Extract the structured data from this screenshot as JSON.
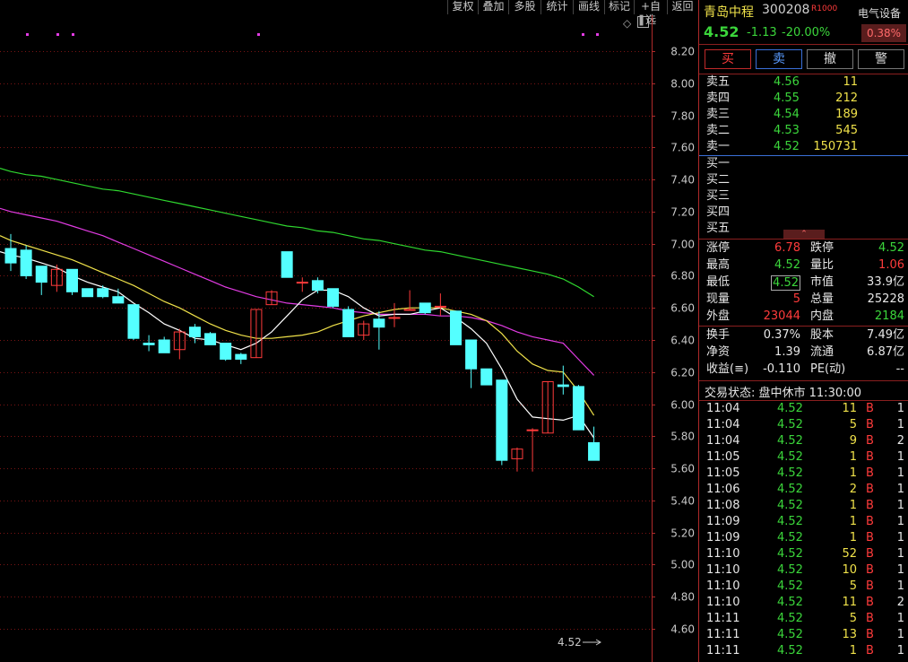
{
  "toolbar": {
    "items": [
      "复权",
      "叠加",
      "多股",
      "统计",
      "画线",
      "标记",
      "+自选",
      "返回"
    ]
  },
  "stock": {
    "name": "青岛中程",
    "code": "300208",
    "tag": "R",
    "sector": "电气设备",
    "sector_change": "0.38%",
    "price": "4.52",
    "change": "-1.13",
    "change_pct": "-20.00%"
  },
  "trade_buttons": [
    "买",
    "卖",
    "撤",
    "警"
  ],
  "asks": [
    {
      "label": "卖五",
      "price": "4.56",
      "vol": "11"
    },
    {
      "label": "卖四",
      "price": "4.55",
      "vol": "212"
    },
    {
      "label": "卖三",
      "price": "4.54",
      "vol": "189"
    },
    {
      "label": "卖二",
      "price": "4.53",
      "vol": "545"
    },
    {
      "label": "卖一",
      "price": "4.52",
      "vol": "150731"
    }
  ],
  "bids": [
    {
      "label": "买一"
    },
    {
      "label": "买二"
    },
    {
      "label": "买三"
    },
    {
      "label": "买四"
    },
    {
      "label": "买五"
    }
  ],
  "stats": [
    {
      "l1": "涨停",
      "v1": "6.78",
      "c1": "red",
      "l2": "跌停",
      "v2": "4.52",
      "c2": "green"
    },
    {
      "l1": "最高",
      "v1": "4.52",
      "c1": "green",
      "l2": "量比",
      "v2": "1.06",
      "c2": "red"
    },
    {
      "l1": "最低",
      "v1": "4.52",
      "c1": "green",
      "l2": "市值",
      "v2": "33.9亿",
      "c2": "white"
    },
    {
      "l1": "现量",
      "v1": "5",
      "c1": "red",
      "l2": "总量",
      "v2": "25228",
      "c2": "white"
    },
    {
      "l1": "外盘",
      "v1": "23044",
      "c1": "red",
      "l2": "内盘",
      "v2": "2184",
      "c2": "green"
    }
  ],
  "stats2": [
    {
      "l1": "换手",
      "v1": "0.37%",
      "l2": "股本",
      "v2": "7.49亿"
    },
    {
      "l1": "净资",
      "v1": "1.39",
      "l2": "流通",
      "v2": "6.87亿"
    },
    {
      "l1": "收益(≡)",
      "v1": "-0.110",
      "l2": "PE(动)",
      "v2": "--"
    }
  ],
  "trade_status": "交易状态: 盘中休市 11:30:00",
  "ticks": [
    {
      "t": "11:04",
      "p": "4.52",
      "v": "11",
      "s": "B",
      "n": "1"
    },
    {
      "t": "11:04",
      "p": "4.52",
      "v": "5",
      "s": "B",
      "n": "1"
    },
    {
      "t": "11:04",
      "p": "4.52",
      "v": "9",
      "s": "B",
      "n": "2"
    },
    {
      "t": "11:05",
      "p": "4.52",
      "v": "1",
      "s": "B",
      "n": "1"
    },
    {
      "t": "11:05",
      "p": "4.52",
      "v": "1",
      "s": "B",
      "n": "1"
    },
    {
      "t": "11:06",
      "p": "4.52",
      "v": "2",
      "s": "B",
      "n": "1"
    },
    {
      "t": "11:08",
      "p": "4.52",
      "v": "1",
      "s": "B",
      "n": "1"
    },
    {
      "t": "11:09",
      "p": "4.52",
      "v": "1",
      "s": "B",
      "n": "1"
    },
    {
      "t": "11:09",
      "p": "4.52",
      "v": "1",
      "s": "B",
      "n": "1"
    },
    {
      "t": "11:10",
      "p": "4.52",
      "v": "52",
      "s": "B",
      "n": "1"
    },
    {
      "t": "11:10",
      "p": "4.52",
      "v": "10",
      "s": "B",
      "n": "1"
    },
    {
      "t": "11:10",
      "p": "4.52",
      "v": "5",
      "s": "B",
      "n": "1"
    },
    {
      "t": "11:10",
      "p": "4.52",
      "v": "11",
      "s": "B",
      "n": "2"
    },
    {
      "t": "11:11",
      "p": "4.52",
      "v": "5",
      "s": "B",
      "n": "1"
    },
    {
      "t": "11:11",
      "p": "4.52",
      "v": "13",
      "s": "B",
      "n": "1"
    },
    {
      "t": "11:11",
      "p": "4.52",
      "v": "1",
      "s": "B",
      "n": "1"
    }
  ],
  "chart_data": {
    "type": "candlestick",
    "ylim": [
      4.55,
      8.3
    ],
    "y_ticks": [
      "8.20",
      "8.00",
      "7.80",
      "7.60",
      "7.40",
      "7.20",
      "7.00",
      "6.80",
      "6.60",
      "6.40",
      "6.20",
      "6.00",
      "5.80",
      "5.60",
      "5.40",
      "5.20",
      "5.00",
      "4.80",
      "4.60"
    ],
    "last_price_label": "4.52",
    "colors": {
      "up": "#ff3b3b",
      "down": "#54ffff",
      "ma5": "#ffffff",
      "ma10": "#f0e24a",
      "ma20": "#e23be3",
      "ma60": "#2fd82f",
      "grid": "#7a1414"
    },
    "candles": [
      {
        "o": 6.97,
        "h": 7.06,
        "c": 6.88,
        "l": 6.83
      },
      {
        "o": 6.96,
        "h": 6.99,
        "c": 6.8,
        "l": 6.78
      },
      {
        "o": 6.86,
        "h": 6.86,
        "c": 6.76,
        "l": 6.68
      },
      {
        "o": 6.74,
        "h": 6.87,
        "c": 6.84,
        "l": 6.7
      },
      {
        "o": 6.84,
        "h": 6.84,
        "c": 6.7,
        "l": 6.68
      },
      {
        "o": 6.72,
        "h": 6.72,
        "c": 6.67,
        "l": 6.67
      },
      {
        "o": 6.72,
        "h": 6.74,
        "c": 6.67,
        "l": 6.66
      },
      {
        "o": 6.67,
        "h": 6.72,
        "c": 6.63,
        "l": 6.63
      },
      {
        "o": 6.62,
        "h": 6.62,
        "c": 6.41,
        "l": 6.4
      },
      {
        "o": 6.38,
        "h": 6.43,
        "c": 6.37,
        "l": 6.33
      },
      {
        "o": 6.4,
        "h": 6.42,
        "c": 6.32,
        "l": 6.32
      },
      {
        "o": 6.34,
        "h": 6.47,
        "c": 6.45,
        "l": 6.28
      },
      {
        "o": 6.48,
        "h": 6.5,
        "c": 6.42,
        "l": 6.38
      },
      {
        "o": 6.44,
        "h": 6.45,
        "c": 6.37,
        "l": 6.37
      },
      {
        "o": 6.38,
        "h": 6.38,
        "c": 6.28,
        "l": 6.27
      },
      {
        "o": 6.31,
        "h": 6.32,
        "c": 6.28,
        "l": 6.25
      },
      {
        "o": 6.29,
        "h": 6.59,
        "c": 6.59,
        "l": 6.29
      },
      {
        "o": 6.62,
        "h": 6.71,
        "c": 6.7,
        "l": 6.62
      },
      {
        "o": 6.95,
        "h": 6.95,
        "c": 6.79,
        "l": 6.79
      },
      {
        "o": 6.76,
        "h": 6.79,
        "c": 6.76,
        "l": 6.7
      },
      {
        "o": 6.77,
        "h": 6.79,
        "c": 6.71,
        "l": 6.69
      },
      {
        "o": 6.72,
        "h": 6.72,
        "c": 6.61,
        "l": 6.6
      },
      {
        "o": 6.59,
        "h": 6.61,
        "c": 6.42,
        "l": 6.42
      },
      {
        "o": 6.43,
        "h": 6.52,
        "c": 6.5,
        "l": 6.4
      },
      {
        "o": 6.53,
        "h": 6.58,
        "c": 6.48,
        "l": 6.34
      },
      {
        "o": 6.54,
        "h": 6.63,
        "c": 6.54,
        "l": 6.48
      },
      {
        "o": 6.59,
        "h": 6.71,
        "c": 6.59,
        "l": 6.59
      },
      {
        "o": 6.63,
        "h": 6.63,
        "c": 6.57,
        "l": 6.56
      },
      {
        "o": 6.61,
        "h": 6.69,
        "c": 6.61,
        "l": 6.55
      },
      {
        "o": 6.58,
        "h": 6.58,
        "c": 6.37,
        "l": 6.37
      },
      {
        "o": 6.4,
        "h": 6.4,
        "c": 6.22,
        "l": 6.1
      },
      {
        "o": 6.22,
        "h": 6.22,
        "c": 6.12,
        "l": 6.12
      },
      {
        "o": 6.15,
        "h": 6.15,
        "c": 5.65,
        "l": 5.62
      },
      {
        "o": 5.66,
        "h": 5.73,
        "c": 5.72,
        "l": 5.58
      },
      {
        "o": 5.84,
        "h": 5.85,
        "c": 5.84,
        "l": 5.58
      },
      {
        "o": 5.82,
        "h": 6.14,
        "c": 6.14,
        "l": 5.82
      },
      {
        "o": 6.12,
        "h": 6.24,
        "c": 6.11,
        "l": 6.06
      },
      {
        "o": 6.11,
        "h": 6.12,
        "c": 5.84,
        "l": 5.84
      },
      {
        "o": 5.76,
        "h": 5.86,
        "c": 5.65,
        "l": 5.65
      }
    ],
    "ma5": [
      6.93,
      6.91,
      6.88,
      6.85,
      6.8,
      6.76,
      6.73,
      6.7,
      6.63,
      6.57,
      6.5,
      6.46,
      6.41,
      6.4,
      6.37,
      6.34,
      6.38,
      6.45,
      6.55,
      6.65,
      6.71,
      6.71,
      6.67,
      6.6,
      6.55,
      6.56,
      6.56,
      6.58,
      6.6,
      6.54,
      6.47,
      6.38,
      6.22,
      6.03,
      5.92,
      5.91,
      5.9,
      5.93,
      5.79
    ],
    "ma10": [
      7.02,
      6.99,
      6.96,
      6.93,
      6.9,
      6.86,
      6.82,
      6.78,
      6.74,
      6.69,
      6.64,
      6.6,
      6.55,
      6.5,
      6.46,
      6.43,
      6.41,
      6.41,
      6.42,
      6.43,
      6.45,
      6.49,
      6.52,
      6.55,
      6.57,
      6.59,
      6.6,
      6.6,
      6.6,
      6.58,
      6.56,
      6.52,
      6.44,
      6.33,
      6.25,
      6.21,
      6.2,
      6.08,
      5.93
    ],
    "ma20": [
      7.2,
      7.18,
      7.16,
      7.14,
      7.11,
      7.08,
      7.05,
      7.01,
      6.97,
      6.93,
      6.89,
      6.85,
      6.81,
      6.77,
      6.73,
      6.7,
      6.67,
      6.65,
      6.63,
      6.62,
      6.61,
      6.6,
      6.58,
      6.57,
      6.56,
      6.56,
      6.56,
      6.56,
      6.55,
      6.55,
      6.54,
      6.52,
      6.49,
      6.45,
      6.42,
      6.4,
      6.38,
      6.28,
      6.18
    ],
    "ma60": [
      7.45,
      7.43,
      7.42,
      7.4,
      7.38,
      7.36,
      7.34,
      7.33,
      7.31,
      7.29,
      7.27,
      7.25,
      7.23,
      7.21,
      7.19,
      7.17,
      7.15,
      7.13,
      7.11,
      7.1,
      7.08,
      7.07,
      7.05,
      7.03,
      7.02,
      7.0,
      6.98,
      6.96,
      6.95,
      6.93,
      6.91,
      6.89,
      6.87,
      6.85,
      6.83,
      6.81,
      6.78,
      6.73,
      6.67
    ]
  }
}
